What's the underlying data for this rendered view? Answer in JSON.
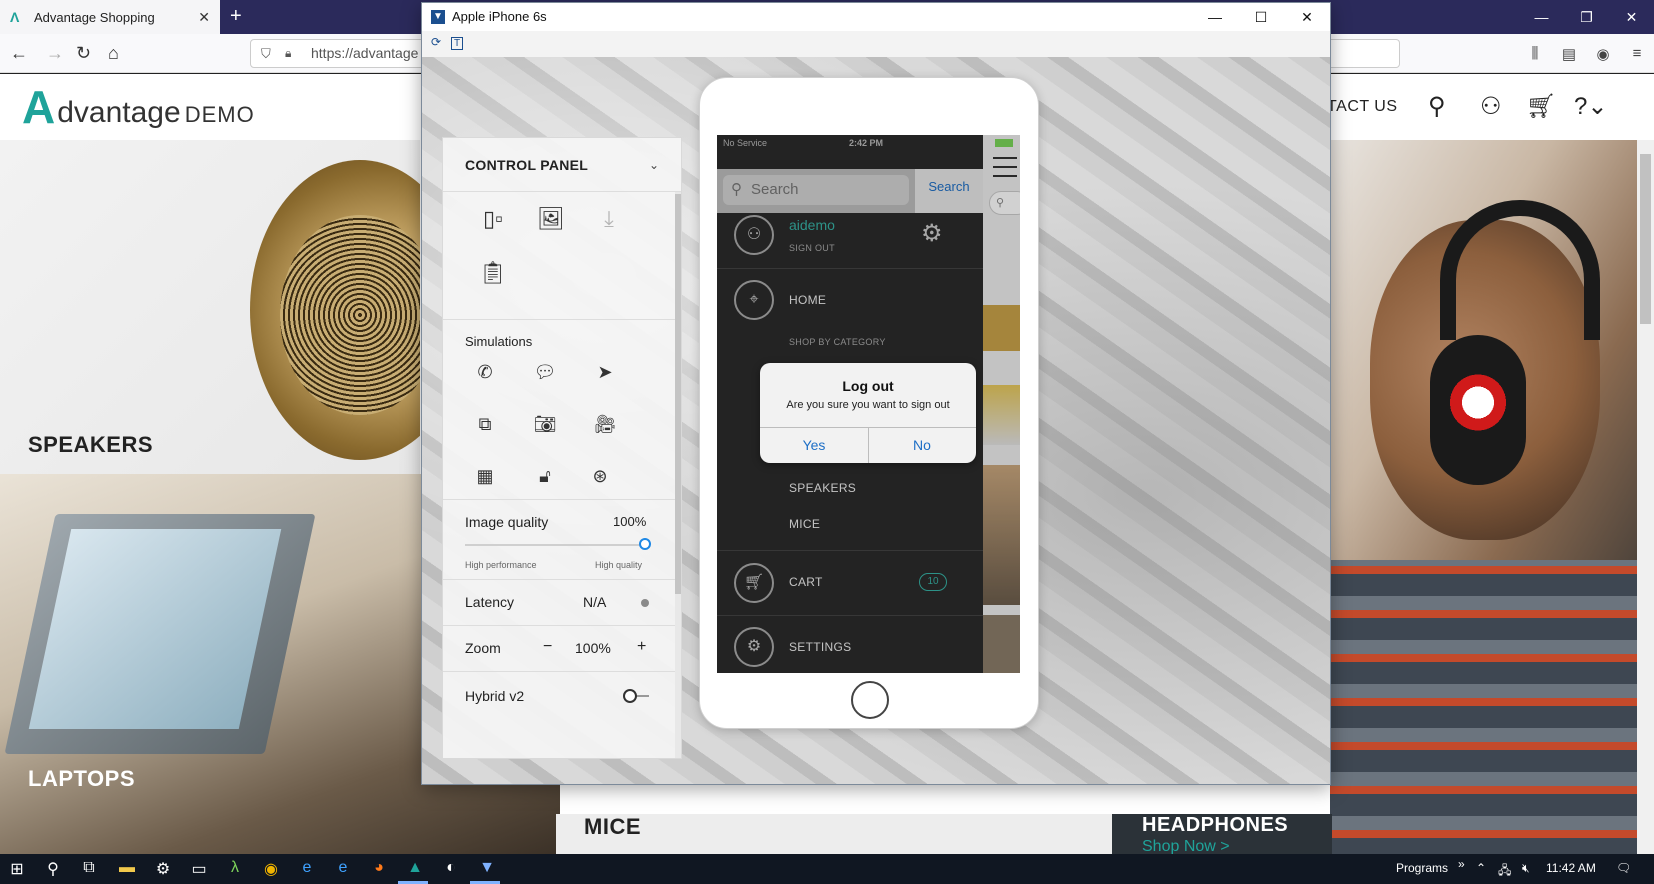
{
  "browser": {
    "tab_title": "Advantage Shopping",
    "url": "https://advantage",
    "new_tab": "+",
    "tab_close": "✕"
  },
  "site": {
    "logo_mark": "A",
    "logo_text": "dvantage",
    "logo_demo": "DEMO",
    "contact_us": "NTACT US",
    "tiles": {
      "speakers": "SPEAKERS",
      "laptops": "LAPTOPS",
      "mice": "MICE",
      "headphones": "HEADPHONES",
      "shop_now": "Shop Now >"
    }
  },
  "emulator": {
    "title": "Apple iPhone 6s",
    "control_panel": {
      "title": "CONTROL PANEL",
      "simulations_title": "Simulations",
      "image_quality_label": "Image quality",
      "image_quality_value": "100%",
      "image_quality_level": 1.0,
      "slider_min_caption": "High performance",
      "slider_max_caption": "High quality",
      "latency_label": "Latency",
      "latency_value": "N/A",
      "zoom_label": "Zoom",
      "zoom_minus": "−",
      "zoom_value": "100%",
      "zoom_plus": "+",
      "hybrid_label": "Hybrid v2",
      "hybrid_on": false
    },
    "phone": {
      "status_carrier": "No Service",
      "status_time": "2:42 PM",
      "search_placeholder": "Search",
      "search_button": "Search",
      "username": "aidemo",
      "sign_out": "SIGN OUT",
      "menu": {
        "home": "HOME",
        "shop_by_category": "SHOP BY CATEGORY",
        "speakers": "SPEAKERS",
        "mice": "MICE",
        "cart": "CART",
        "cart_count": "10",
        "settings": "SETTINGS"
      },
      "dialog": {
        "title": "Log out",
        "message": "Are you sure you want to sign out",
        "yes": "Yes",
        "no": "No"
      }
    }
  },
  "taskbar": {
    "programs_label": "Programs",
    "programs_chevron": "»",
    "clock": "11:42 AM"
  },
  "colors": {
    "brand_teal": "#1fa39a",
    "ios_blue": "#1e6fc6",
    "taskbar_bg": "#101722"
  }
}
